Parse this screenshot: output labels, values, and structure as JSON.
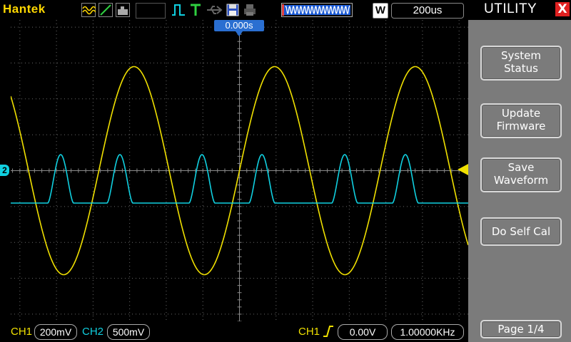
{
  "brand": "Hantek",
  "timebase": {
    "mode_badge": "W",
    "value": "200us"
  },
  "trigger_position": "0.000s",
  "menu": {
    "title": "UTILITY",
    "close_glyph": "X",
    "buttons": [
      {
        "line1": "System",
        "line2": "Status"
      },
      {
        "line1": "Update",
        "line2": "Firmware"
      },
      {
        "line1": "Save",
        "line2": "Waveform"
      },
      {
        "line1": "Do Self Cal",
        "line2": ""
      }
    ],
    "page": "Page 1/4"
  },
  "channels": [
    {
      "label": "CH1",
      "scale": "200mV",
      "color": "#f0e000"
    },
    {
      "label": "CH2",
      "scale": "500mV",
      "color": "#10d0e0"
    }
  ],
  "channel_markers": {
    "ch2": "2"
  },
  "trigger": {
    "source": "CH1",
    "level": "0.00V",
    "frequency": "1.00000KHz"
  },
  "colors": {
    "ch1": "#f0e000",
    "ch2": "#10d0e0",
    "grid": "#6a6a6a",
    "menu_bg": "#7b7b7b"
  }
}
